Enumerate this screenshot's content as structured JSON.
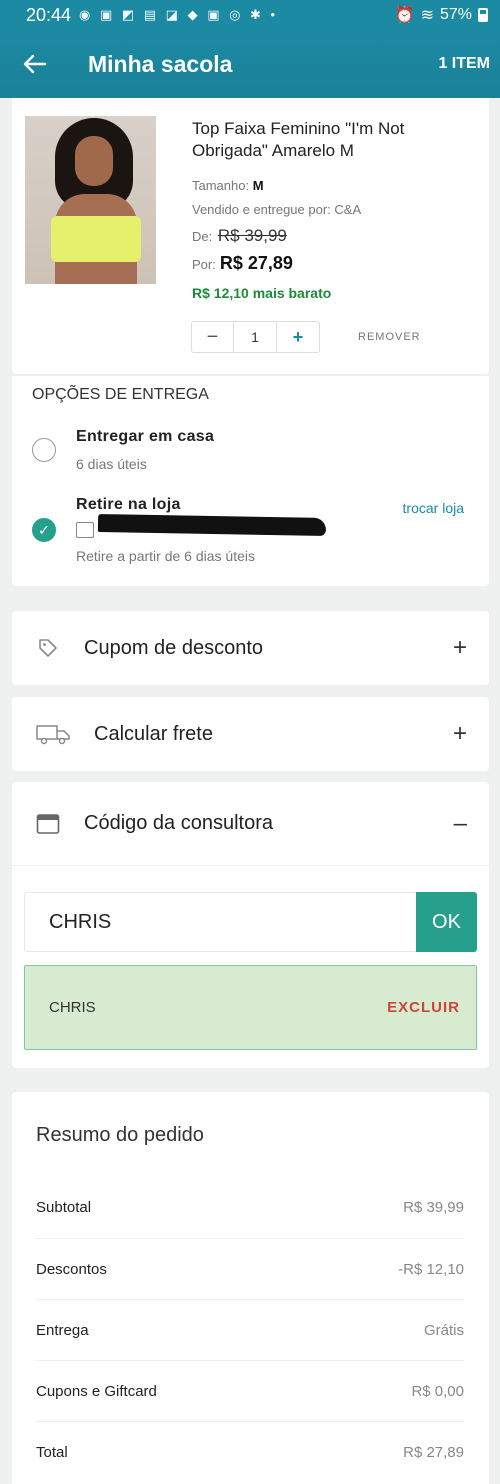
{
  "status_bar": {
    "time": "20:44",
    "battery": "57%"
  },
  "header": {
    "back_icon": "arrow-left-icon",
    "title": "Minha sacola",
    "item_count": "1 ITEM"
  },
  "product": {
    "name": "Top Faixa Feminino \"I'm Not Obrigada\" Amarelo M",
    "size_label": "Tamanho:",
    "size_value": "M",
    "seller": "Vendido e entregue por: C&A",
    "old_price_label": "De:",
    "old_price": "R$ 39,99",
    "new_price_label": "Por:",
    "new_price": "R$ 27,89",
    "savings": "R$ 12,10 mais barato",
    "quantity": "1",
    "remove_label": "REMOVER"
  },
  "delivery": {
    "heading": "OPÇÕES DE ENTREGA",
    "home_title": "Entregar em casa",
    "home_sub": "6 dias úteis",
    "store_title": "Retire na loja",
    "store_sub": "Retire a partir de 6 dias úteis",
    "change_store": "trocar loja",
    "selected": "store"
  },
  "accordions": {
    "coupon": {
      "label": "Cupom de desconto",
      "icon": "tag-icon",
      "toggle": "+"
    },
    "shipping": {
      "label": "Calcular frete",
      "icon": "truck-icon",
      "toggle": "+"
    },
    "consultant": {
      "label": "Código da consultora",
      "icon": "calendar-icon",
      "toggle": "–"
    }
  },
  "consultant": {
    "input_value": "CHRIS",
    "ok_label": "OK",
    "applied_code": "CHRIS",
    "delete_label": "EXCLUIR"
  },
  "summary": {
    "title": "Resumo do pedido",
    "rows": [
      {
        "label": "Subtotal",
        "value": "R$ 39,99"
      },
      {
        "label": "Descontos",
        "value": "-R$ 12,10"
      },
      {
        "label": "Entrega",
        "value": "Grátis"
      },
      {
        "label": "Cupons e Giftcard",
        "value": "R$ 0,00"
      },
      {
        "label": "Total",
        "value": "R$ 27,89"
      }
    ]
  },
  "colors": {
    "primary": "#1d8aa3",
    "accent": "#26a08c",
    "savings": "#1f8a3a",
    "danger": "#d0453a"
  }
}
